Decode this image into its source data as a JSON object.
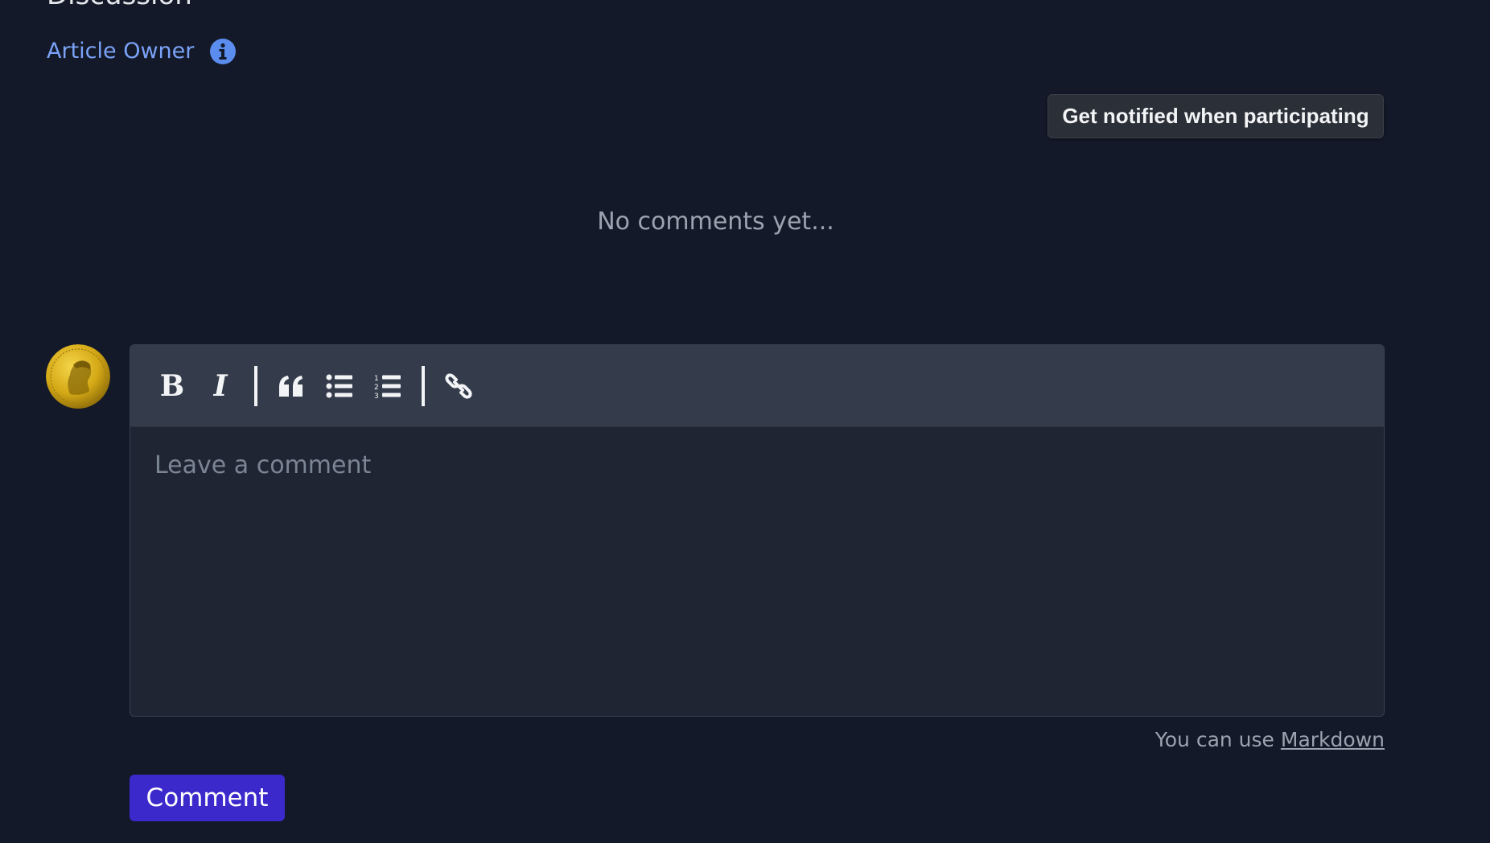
{
  "section": {
    "title": "Discussion"
  },
  "owner": {
    "label": "Article Owner",
    "info_icon": "info-circle-icon"
  },
  "notify_button": {
    "label": "Get notified when participating"
  },
  "comments": {
    "empty_text": "No comments yet..."
  },
  "editor": {
    "toolbar": {
      "bold_label": "B",
      "italic_label": "I",
      "icons": [
        "bold-icon",
        "italic-icon",
        "quote-icon",
        "unordered-list-icon",
        "ordered-list-icon",
        "link-icon"
      ]
    },
    "placeholder": "Leave a comment",
    "value": ""
  },
  "hint": {
    "prefix": "You can use",
    "link_text": "Markdown"
  },
  "submit": {
    "label": "Comment"
  },
  "colors": {
    "background": "#131928",
    "link": "#7aa2f7",
    "primary_button": "#3b29cc",
    "toolbar": "#343c4b",
    "editor": "#1f2533"
  }
}
